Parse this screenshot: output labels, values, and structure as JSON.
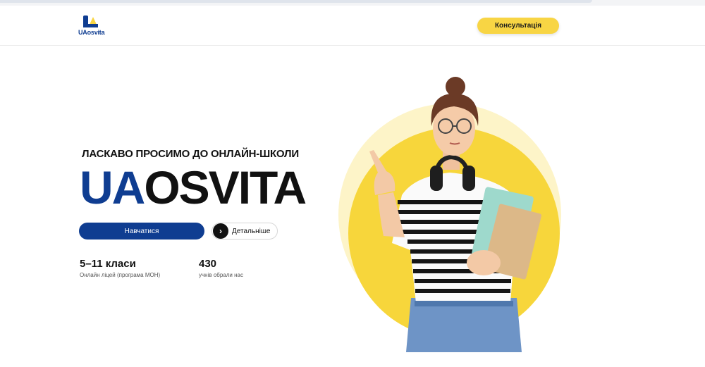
{
  "header": {
    "logo_text": "UAosvita",
    "consult_label": "Консультація"
  },
  "hero": {
    "welcome": "ЛАСКАВО ПРОСИМО ДО ОНЛАЙН-ШКОЛИ",
    "brand_ua": "UA",
    "brand_rest": "OSVITA",
    "learn_label": "Навчатися",
    "details_label": "Детальніше"
  },
  "stats": [
    {
      "value": "5–11 класи",
      "desc": "Онлайн ліцей (програма МОН)"
    },
    {
      "value": "430",
      "desc": "учнів обрали нас"
    }
  ],
  "colors": {
    "brand_blue": "#0f3d91",
    "accent_yellow": "#f8d544",
    "text_dark": "#111111"
  },
  "icons": {
    "logo": "ua-logo-icon",
    "details_arrow": "chevron-right-icon"
  }
}
